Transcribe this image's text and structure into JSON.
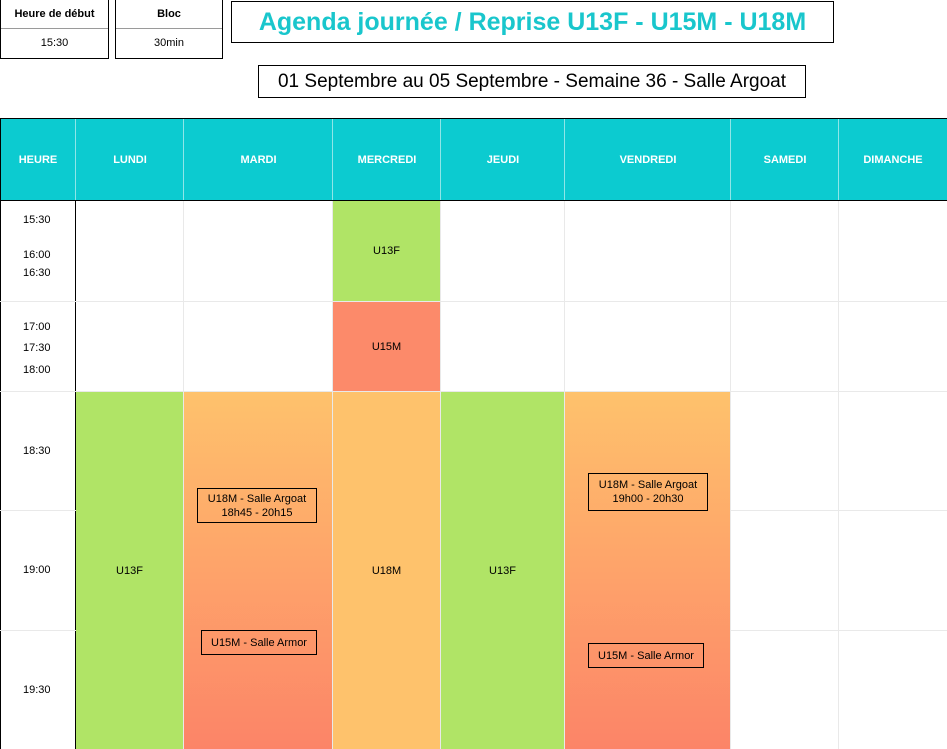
{
  "info": {
    "start_label": "Heure de début",
    "start_value": "15:30",
    "block_label": "Bloc",
    "block_value": "30min"
  },
  "title": "Agenda journée / Reprise U13F - U15M - U18M",
  "subtitle": "01 Septembre au 05 Septembre - Semaine 36 - Salle Argoat",
  "header": {
    "hour": "HEURE",
    "days": [
      "LUNDI",
      "MARDI",
      "MERCREDI",
      "JEUDI",
      "VENDREDI",
      "SAMEDI",
      "DIMANCHE"
    ]
  },
  "times": [
    "15:30",
    "16:00",
    "16:30",
    "17:00",
    "17:30",
    "18:00",
    "18:30",
    "19:00",
    "19:30"
  ],
  "events": {
    "mercredi_1": "U13F",
    "mercredi_2": "U15M",
    "mercredi_3": "U18M",
    "lundi": "U13F",
    "jeudi": "U13F"
  },
  "notes": {
    "mardi_1_line1": "U18M - Salle Argoat",
    "mardi_1_line2": "18h45 - 20h15",
    "mardi_2": "U15M - Salle Armor",
    "vendredi_1_line1": "U18M - Salle Argoat",
    "vendredi_1_line2": "19h00 - 20h30",
    "vendredi_2": "U15M - Salle Armor"
  },
  "colors": {
    "accent": "#0ccbd0",
    "title": "#19c6cc",
    "green": "#b0e466",
    "red": "#fc8a6a",
    "orange": "#fec26c"
  }
}
